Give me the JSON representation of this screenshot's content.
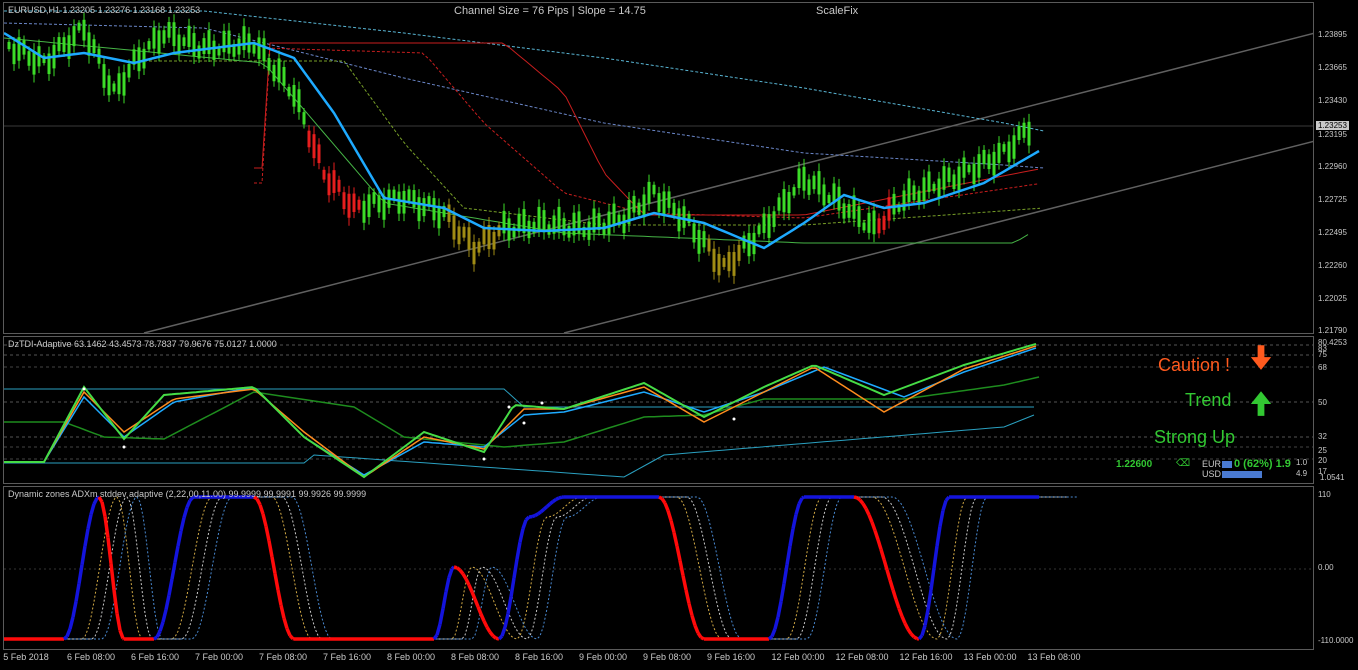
{
  "window": {
    "symbol_title": "EURUSD,H1",
    "ohlc": "1.23205 1.23276 1.23168 1.23253",
    "channel_info": "Channel Size = 76 Pips  |  Slope = 14.75",
    "scalefix": "ScaleFix"
  },
  "main_axis": {
    "ticks": [
      "1.23895",
      "1.23665",
      "1.23430",
      "1.23195",
      "1.22960",
      "1.22725",
      "1.22495",
      "1.22260",
      "1.22025",
      "1.21790"
    ],
    "current_price": "1.23253"
  },
  "tdi_panel": {
    "title": "DzTDI-Adaptive 63.1462 43.4573 78.7837 79.9676 75.0127 1.0000",
    "ticks": [
      "83",
      "75",
      "68",
      "50",
      "32",
      "25",
      "20",
      "17"
    ],
    "top_value": "80.4253",
    "bottom_value": "1.0541",
    "signals": [
      {
        "label": "Caution !",
        "color": "#ff5a1e"
      },
      {
        "label": "Trend",
        "color": "#32c832"
      },
      {
        "label": "Strong Up",
        "color": "#32c832"
      }
    ],
    "price_readout": "1.22600",
    "eur_label": "EUR",
    "usd_label": "USD",
    "strength_text": "0 (62%)  1.9",
    "strength_small_1": "1.0",
    "strength_small_2": "4.9"
  },
  "adx_panel": {
    "title": "Dynamic zones ADXm stddev adaptive (2,22,00,11.00) 99.9999 99.9991 99.9926 99.9999",
    "ticks": [
      "110",
      "0.00",
      "-110.0000"
    ]
  },
  "time_axis": [
    "5 Feb 2018",
    "6 Feb 08:00",
    "6 Feb 16:00",
    "7 Feb 00:00",
    "7 Feb 08:00",
    "7 Feb 16:00",
    "8 Feb 00:00",
    "8 Feb 08:00",
    "8 Feb 16:00",
    "9 Feb 00:00",
    "9 Feb 08:00",
    "9 Feb 16:00",
    "12 Feb 00:00",
    "12 Feb 08:00",
    "12 Feb 16:00",
    "13 Feb 00:00",
    "13 Feb 08:00"
  ],
  "colors": {
    "bull": "#3cdc28",
    "bear": "#e61e1e",
    "neutral": "#a08c14",
    "ma_fast": "#1eaaff",
    "channel": "#606060",
    "blue_line": "#1414dc",
    "red_line": "#ff0a0a"
  }
}
